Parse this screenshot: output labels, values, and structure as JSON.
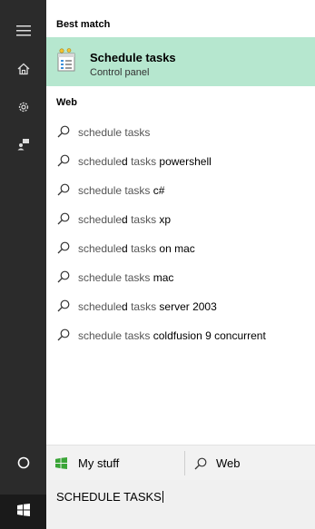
{
  "rail": {
    "icons": [
      "hamburger-menu-icon",
      "home-icon",
      "settings-icon",
      "feedback-icon"
    ],
    "cortana_icon": "cortana-circle-icon",
    "start_icon": "windows-start-icon"
  },
  "best_match": {
    "heading": "Best match",
    "title": "Schedule tasks",
    "subtitle": "Control panel",
    "icon": "task-scheduler-icon",
    "highlight_color": "#b6e7cf"
  },
  "web": {
    "heading": "Web",
    "items": [
      {
        "q": "schedule",
        "s": "",
        "t": " tasks",
        "u": ""
      },
      {
        "q": "schedule",
        "s": "d",
        "t": " tasks",
        "u": " powershell"
      },
      {
        "q": "schedule",
        "s": "",
        "t": " tasks",
        "u": " c#"
      },
      {
        "q": "schedule",
        "s": "d",
        "t": " tasks",
        "u": " xp"
      },
      {
        "q": "schedule",
        "s": "d",
        "t": " tasks",
        "u": " on mac"
      },
      {
        "q": "schedule",
        "s": "",
        "t": " tasks",
        "u": " mac"
      },
      {
        "q": "schedule",
        "s": "d",
        "t": " tasks",
        "u": " server 2003"
      },
      {
        "q": "schedule",
        "s": "",
        "t": " tasks",
        "u": " coldfusion 9 concurrent"
      }
    ]
  },
  "filters": {
    "my_stuff": "My stuff",
    "web": "Web"
  },
  "search": {
    "value": "SCHEDULE TASKS"
  },
  "colors": {
    "rail": "#2b2b2b",
    "windows_green": "#3aa537"
  }
}
